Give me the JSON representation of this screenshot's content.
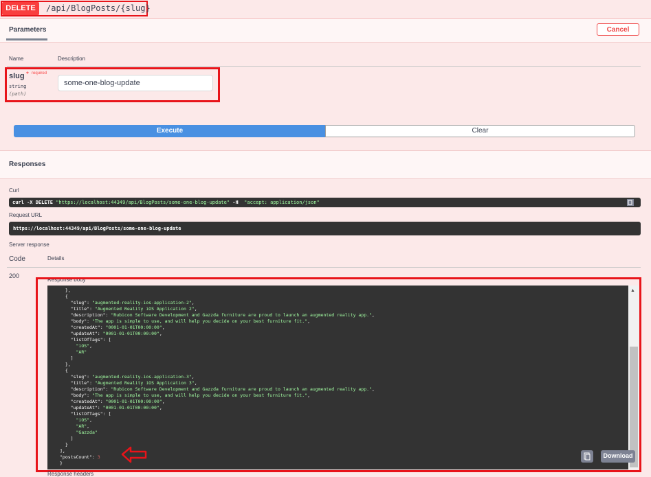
{
  "operation": {
    "method": "DELETE",
    "path": "/api/BlogPosts/{slug}"
  },
  "tabs": {
    "parameters": "Parameters",
    "cancel": "Cancel"
  },
  "params_table": {
    "col_name": "Name",
    "col_description": "Description",
    "param": {
      "name": "slug",
      "required_mark": "*",
      "required_text": "required",
      "type": "string",
      "in": "(path)",
      "value": "some-one-blog-update"
    }
  },
  "actions": {
    "execute": "Execute",
    "clear": "Clear"
  },
  "responses": {
    "title": "Responses",
    "curl_label": "Curl",
    "curl_prefix": "curl -X DELETE ",
    "curl_url": "\"https://localhost:44349/api/BlogPosts/some-one-blog-update\"",
    "curl_mid": " -H  ",
    "curl_header": "\"accept: application/json\"",
    "request_url_label": "Request URL",
    "request_url": "https://localhost:44349/api/BlogPosts/some-one-blog-update",
    "server_response_label": "Server response",
    "code_header": "Code",
    "details_header": "Details",
    "code": "200",
    "response_body_label": "Response body",
    "download": "Download",
    "response_headers_label": "Response headers"
  },
  "response_body": {
    "posts": [
      {
        "slug": "augmented-reality-ios-application-2",
        "title": "Augmented Reality iOS Application 2",
        "description": "Rubicon Software Development and Gazzda furniture are proud to launch an augmented reality app.",
        "body": "The app is simple to use, and will help you decide on your best furniture fit.",
        "createdAt": "0001-01-01T00:00:00",
        "updateAt": "0001-01-01T00:00:00",
        "listOfTags": [
          "iOS",
          "AR"
        ]
      },
      {
        "slug": "augmented-reality-ios-application-3",
        "title": "Augmented Reality iOS Application 3",
        "description": "Rubicon Software Development and Gazzda furniture are proud to launch an augmented reality app.",
        "body": "The app is simple to use, and will help you decide on your best furniture fit.",
        "createdAt": "0001-01-01T00:00:00",
        "updateAt": "0001-01-01T00:00:00",
        "listOfTags": [
          "iOS",
          "AR",
          "Gazzda"
        ]
      }
    ],
    "postsCount": 3
  },
  "colors": {
    "method_delete": "#f93e3e",
    "highlight_border": "#e8141a",
    "execute_blue": "#4990e2",
    "code_bg": "#333333",
    "json_string": "#a2fca2",
    "json_number": "#d36363"
  },
  "icons": {
    "copy": "copy-icon",
    "arrow": "left-arrow-icon"
  }
}
